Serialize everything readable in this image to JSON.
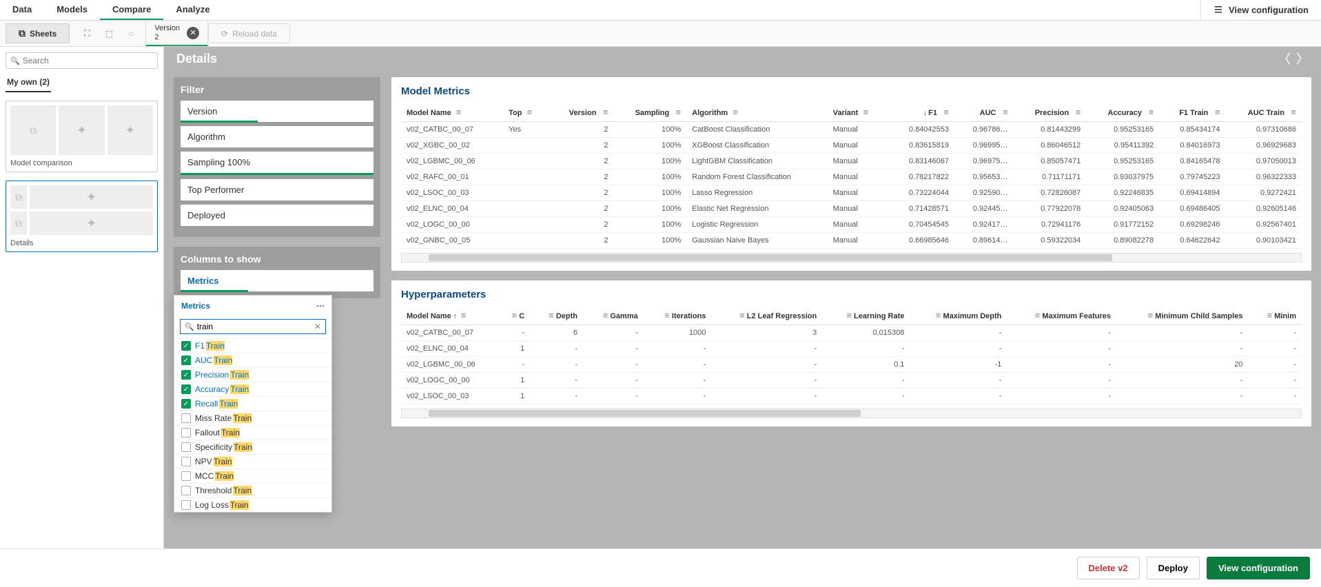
{
  "topnav": {
    "tabs": [
      "Data",
      "Models",
      "Compare",
      "Analyze"
    ],
    "active": 2,
    "view_config": "View configuration"
  },
  "toolrow": {
    "sheets": "Sheets",
    "version_label": "Version",
    "version_value": "2",
    "reload": "Reload data"
  },
  "sidebar": {
    "search_placeholder": "Search",
    "myown": "My own (2)",
    "thumbs": [
      {
        "label": "Model comparison"
      },
      {
        "label": "Details"
      }
    ]
  },
  "main": {
    "title": "Details"
  },
  "filter": {
    "title": "Filter",
    "items": [
      {
        "label": "Version",
        "active": true,
        "partial": true
      },
      {
        "label": "Algorithm",
        "active": false
      },
      {
        "label": "Sampling 100%",
        "active": true,
        "partial": false
      },
      {
        "label": "Top Performer",
        "active": false
      },
      {
        "label": "Deployed",
        "active": false
      }
    ]
  },
  "columns": {
    "title": "Columns to show",
    "active": "Metrics"
  },
  "metrics_popup": {
    "title": "Metrics",
    "search_value": "train",
    "items": [
      {
        "prefix": "F1 ",
        "hl": "Train",
        "checked": true
      },
      {
        "prefix": "AUC ",
        "hl": "Train",
        "checked": true
      },
      {
        "prefix": "Precision ",
        "hl": "Train",
        "checked": true
      },
      {
        "prefix": "Accuracy ",
        "hl": "Train",
        "checked": true
      },
      {
        "prefix": "Recall ",
        "hl": "Train",
        "checked": true
      },
      {
        "prefix": "Miss Rate ",
        "hl": "Train",
        "checked": false
      },
      {
        "prefix": "Fallout ",
        "hl": "Train",
        "checked": false
      },
      {
        "prefix": "Specificity ",
        "hl": "Train",
        "checked": false
      },
      {
        "prefix": "NPV ",
        "hl": "Train",
        "checked": false
      },
      {
        "prefix": "MCC ",
        "hl": "Train",
        "checked": false
      },
      {
        "prefix": "Threshold ",
        "hl": "Train",
        "checked": false
      },
      {
        "prefix": "Log Loss ",
        "hl": "Train",
        "checked": false
      }
    ]
  },
  "model_metrics": {
    "title": "Model Metrics",
    "columns": [
      "Model Name",
      "Top",
      "Version",
      "Sampling",
      "Algorithm",
      "Variant",
      "F1",
      "AUC",
      "Precision",
      "Accuracy",
      "F1 Train",
      "AUC Train"
    ],
    "sort_col": "F1",
    "rows": [
      {
        "name": "v02_CATBC_00_07",
        "top": "Yes",
        "version": 2,
        "sampling": "100%",
        "algo": "CatBoost Classification",
        "variant": "Manual",
        "f1": "0.84042553",
        "auc": "0.96786…",
        "prec": "0.81443299",
        "acc": "0.95253165",
        "f1t": "0.85434174",
        "auct": "0.97310686"
      },
      {
        "name": "v02_XGBC_00_02",
        "top": "",
        "version": 2,
        "sampling": "100%",
        "algo": "XGBoost Classification",
        "variant": "Manual",
        "f1": "0.83615819",
        "auc": "0.96995…",
        "prec": "0.86046512",
        "acc": "0.95411392",
        "f1t": "0.84016973",
        "auct": "0.96929683"
      },
      {
        "name": "v02_LGBMC_00_06",
        "top": "",
        "version": 2,
        "sampling": "100%",
        "algo": "LightGBM Classification",
        "variant": "Manual",
        "f1": "0.83146067",
        "auc": "0.96975…",
        "prec": "0.85057471",
        "acc": "0.95253165",
        "f1t": "0.84165478",
        "auct": "0.97050013"
      },
      {
        "name": "v02_RAFC_00_01",
        "top": "",
        "version": 2,
        "sampling": "100%",
        "algo": "Random Forest Classification",
        "variant": "Manual",
        "f1": "0.78217822",
        "auc": "0.95653…",
        "prec": "0.71171171",
        "acc": "0.93037975",
        "f1t": "0.79745223",
        "auct": "0.96322333"
      },
      {
        "name": "v02_LSOC_00_03",
        "top": "",
        "version": 2,
        "sampling": "100%",
        "algo": "Lasso Regression",
        "variant": "Manual",
        "f1": "0.73224044",
        "auc": "0.92590…",
        "prec": "0.72826087",
        "acc": "0.92246835",
        "f1t": "0.69414894",
        "auct": "0.9272421"
      },
      {
        "name": "v02_ELNC_00_04",
        "top": "",
        "version": 2,
        "sampling": "100%",
        "algo": "Elastic Net Regression",
        "variant": "Manual",
        "f1": "0.71428571",
        "auc": "0.92445…",
        "prec": "0.77922078",
        "acc": "0.92405063",
        "f1t": "0.69486405",
        "auct": "0.92605146"
      },
      {
        "name": "v02_LOGC_00_00",
        "top": "",
        "version": 2,
        "sampling": "100%",
        "algo": "Logistic Regression",
        "variant": "Manual",
        "f1": "0.70454545",
        "auc": "0.92417…",
        "prec": "0.72941176",
        "acc": "0.91772152",
        "f1t": "0.69298246",
        "auct": "0.92567401"
      },
      {
        "name": "v02_GNBC_00_05",
        "top": "",
        "version": 2,
        "sampling": "100%",
        "algo": "Gaussian Naive Bayes",
        "variant": "Manual",
        "f1": "0.66985646",
        "auc": "0.89614…",
        "prec": "0.59322034",
        "acc": "0.89082278",
        "f1t": "0.64622642",
        "auct": "0.90103421"
      }
    ]
  },
  "hyperparams": {
    "title": "Hyperparameters",
    "columns": [
      "Model Name",
      "C",
      "Depth",
      "Gamma",
      "Iterations",
      "L2 Leaf Regression",
      "Learning Rate",
      "Maximum Depth",
      "Maximum Features",
      "Minimum Child Samples",
      "Minim"
    ],
    "sort_col": "Model Name",
    "rows": [
      {
        "name": "v02_CATBC_00_07",
        "c": "-",
        "depth": "6",
        "gamma": "-",
        "iter": "1000",
        "l2": "3",
        "lr": "0.015308",
        "maxd": "-",
        "maxf": "-",
        "mcs": "-",
        "min": "-"
      },
      {
        "name": "v02_ELNC_00_04",
        "c": "1",
        "depth": "-",
        "gamma": "-",
        "iter": "-",
        "l2": "-",
        "lr": "-",
        "maxd": "-",
        "maxf": "-",
        "mcs": "-",
        "min": "-"
      },
      {
        "name": "v02_LGBMC_00_06",
        "c": "-",
        "depth": "-",
        "gamma": "-",
        "iter": "-",
        "l2": "-",
        "lr": "0.1",
        "maxd": "-1",
        "maxf": "-",
        "mcs": "20",
        "min": "-"
      },
      {
        "name": "v02_LOGC_00_00",
        "c": "1",
        "depth": "-",
        "gamma": "-",
        "iter": "-",
        "l2": "-",
        "lr": "-",
        "maxd": "-",
        "maxf": "-",
        "mcs": "-",
        "min": "-"
      },
      {
        "name": "v02_LSOC_00_03",
        "c": "1",
        "depth": "-",
        "gamma": "-",
        "iter": "-",
        "l2": "-",
        "lr": "-",
        "maxd": "-",
        "maxf": "-",
        "mcs": "-",
        "min": "-"
      }
    ]
  },
  "footer": {
    "delete": "Delete v2",
    "deploy": "Deploy",
    "view": "View configuration"
  }
}
